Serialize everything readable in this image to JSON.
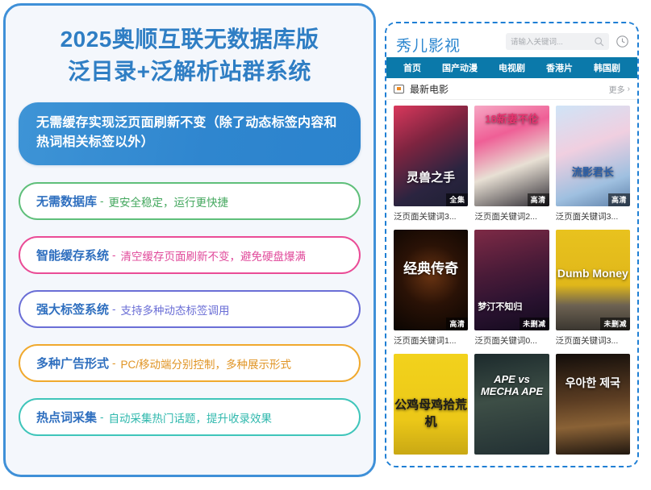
{
  "left": {
    "title_line1": "2025奥顺互联无数据库版",
    "title_line2": "泛目录+泛解析站群系统",
    "hero": {
      "text": "无需缓存实现泛页面刷新不变（除了动态标签内容和热词相关标签以外）"
    },
    "features": [
      {
        "title": "无需数据库",
        "sep": "-",
        "desc": "更安全稳定，运行更快捷",
        "border": "#5fbf7a",
        "desc_color": "#45a85f"
      },
      {
        "title": "智能缓存系统",
        "sep": "-",
        "desc": "清空缓存页面刷新不变，避免硬盘爆满",
        "border": "#ea4c96",
        "desc_color": "#e0499a"
      },
      {
        "title": "强大标签系统",
        "sep": "-",
        "desc": "支持多种动态标签调用",
        "border": "#6a6ed6",
        "desc_color": "#6a6ed6"
      },
      {
        "title": "多种广告形式",
        "sep": "-",
        "desc": "PC/移动端分别控制，多种展示形式",
        "border": "#f0a92e",
        "desc_color": "#e09424"
      },
      {
        "title": "热点词采集",
        "sep": "-",
        "desc": "自动采集热门话题，提升收录效果",
        "border": "#3fc5ba",
        "desc_color": "#2fb8ad"
      }
    ]
  },
  "phone": {
    "logo": "秀儿影视",
    "search": {
      "placeholder": "请输入关键词...",
      "value": "",
      "icon": "search-icon"
    },
    "history_icon": "clock-icon",
    "nav": [
      {
        "label": "首页",
        "active": true
      },
      {
        "label": "国产动漫",
        "active": false
      },
      {
        "label": "电视剧",
        "active": false
      },
      {
        "label": "香港片",
        "active": false
      },
      {
        "label": "韩国剧",
        "active": false
      }
    ],
    "section": {
      "title": "最新电影",
      "icon": "tv-icon",
      "more_label": "更多",
      "more_chevron": "›"
    },
    "movies": [
      {
        "caption": "泛页面关键词3...",
        "badge": "全集",
        "poster_title": "灵兽之手",
        "art": "art1"
      },
      {
        "caption": "泛页面关键词2...",
        "badge": "高清",
        "poster_title": "18新妻不伦",
        "art": "art2"
      },
      {
        "caption": "泛页面关键词3...",
        "badge": "高清",
        "poster_title": "流影君长",
        "art": "art3"
      },
      {
        "caption": "泛页面关键词1...",
        "badge": "高清",
        "poster_title": "经典传奇",
        "art": "art4"
      },
      {
        "caption": "泛页面关键词0...",
        "badge": "未删减",
        "poster_title": "梦汀不知归",
        "art": "art5"
      },
      {
        "caption": "泛页面关键词3...",
        "badge": "未删减",
        "poster_title": "Dumb Money",
        "art": "art6"
      },
      {
        "caption": "",
        "badge": "",
        "poster_title": "公鸡母鸡拾荒机",
        "art": "art7"
      },
      {
        "caption": "",
        "badge": "",
        "poster_title": "APE vs MECHA APE",
        "art": "art8"
      },
      {
        "caption": "",
        "badge": "",
        "poster_title": "우아한 제국",
        "art": "art9"
      }
    ]
  },
  "colors": {
    "panel_border": "#3f90d8",
    "panel_bg": "#f4f7fc",
    "title_blue": "#2f7ec4",
    "hero_blue": "#2f86cf",
    "nav_bg": "#0b79aa",
    "logo_blue": "#2b86cf",
    "phone_border": "#1f7fd4"
  }
}
